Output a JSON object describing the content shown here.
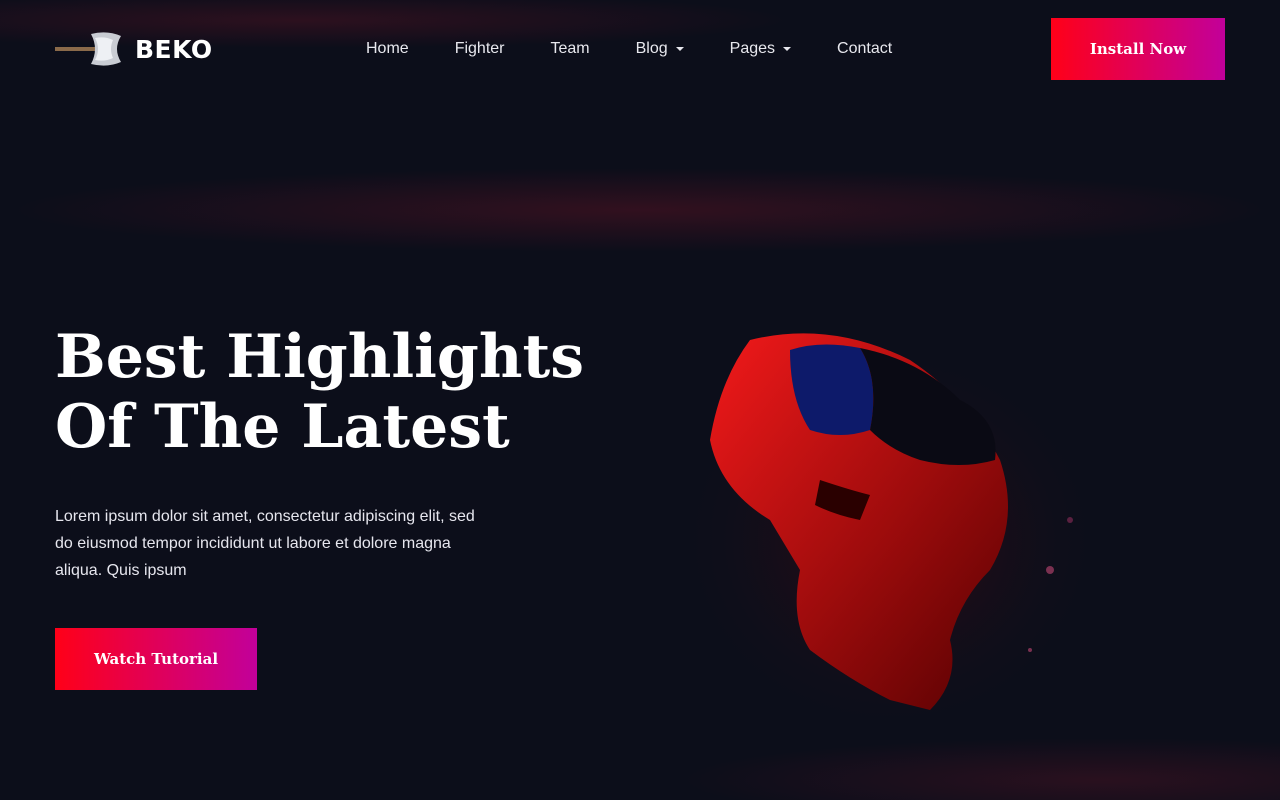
{
  "brand": {
    "name": "BEKO",
    "logo_icon": "axe-icon"
  },
  "nav": {
    "items": [
      {
        "label": "Home",
        "dropdown": false
      },
      {
        "label": "Fighter",
        "dropdown": false
      },
      {
        "label": "Team",
        "dropdown": false
      },
      {
        "label": "Blog",
        "dropdown": true
      },
      {
        "label": "Pages",
        "dropdown": true
      },
      {
        "label": "Contact",
        "dropdown": false
      }
    ]
  },
  "header": {
    "install_label": "Install Now"
  },
  "hero": {
    "title_line1": "Best Highlights",
    "title_line2": "Of The Latest",
    "text": "Lorem ipsum dolor sit amet, consectetur adipiscing elit, sed do eiusmod tempor incididunt ut labore et dolore magna aliqua. Quis ipsum",
    "cta_label": "Watch Tutorial",
    "art_icon": "vr-gamer-illustration"
  },
  "colors": {
    "background": "#0c0e1a",
    "accent_start": "#ff0018",
    "accent_end": "#c2009a"
  }
}
